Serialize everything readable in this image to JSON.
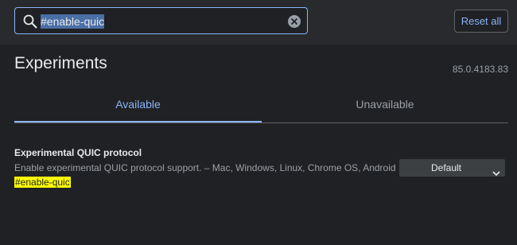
{
  "search": {
    "query": "#enable-quic"
  },
  "header": {
    "reset_label": "Reset all"
  },
  "main": {
    "title": "Experiments",
    "version": "85.0.4183.83",
    "tabs": [
      {
        "label": "Available",
        "active": true
      },
      {
        "label": "Unavailable",
        "active": false
      }
    ]
  },
  "experiments": [
    {
      "title": "Experimental QUIC protocol",
      "description": "Enable experimental QUIC protocol support. – Mac, Windows, Linux, Chrome OS, Android",
      "link": "#enable-quic",
      "selected_option": "Default"
    }
  ],
  "colors": {
    "accent": "#8ab4f8",
    "background": "#202124",
    "header": "#292a2d",
    "highlight": "#ffff00"
  },
  "icons": [
    "search-icon",
    "clear-icon",
    "chevron-down-icon"
  ]
}
